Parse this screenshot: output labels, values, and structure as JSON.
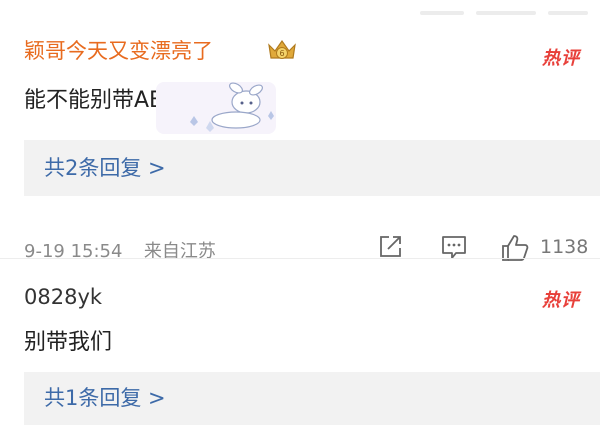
{
  "comments": [
    {
      "username": "颖哥今天又变漂亮了",
      "hot_label": "热评",
      "text": "能不能别带AB",
      "replies_label": "共2条回复 >",
      "timestamp": "9-19 15:54",
      "source": "来自江苏",
      "likes": "1138"
    },
    {
      "username": "0828yk",
      "hot_label": "热评",
      "text": "别带我们",
      "replies_label": "共1条回复 >"
    }
  ],
  "colors": {
    "accent": "#e86b1f",
    "hot": "#e8403a",
    "link": "#3d6aa8",
    "reply_bg": "#f2f2f2"
  },
  "icons": [
    "crown-badge-icon",
    "bunny-sticker-icon",
    "share-icon",
    "comment-icon",
    "thumbs-up-icon"
  ]
}
